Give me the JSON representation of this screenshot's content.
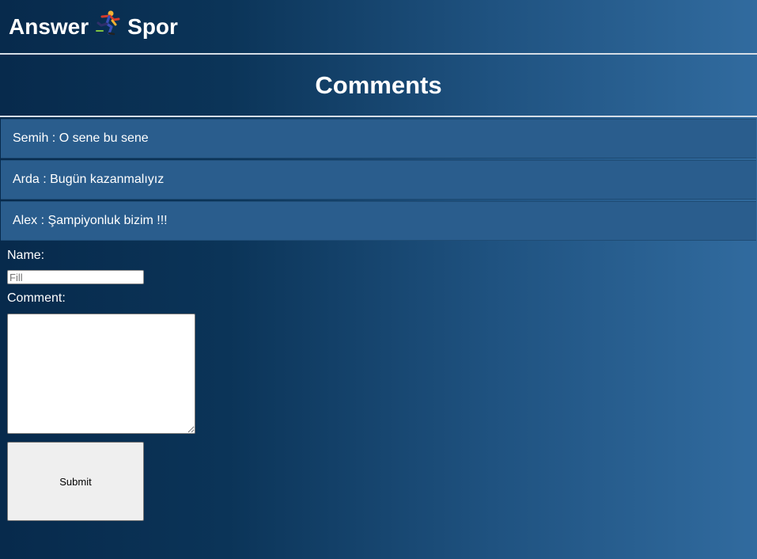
{
  "header": {
    "brand_left": "Answer",
    "brand_icon": "runner-icon",
    "brand_right": "Spor"
  },
  "page": {
    "title": "Comments"
  },
  "comments": [
    {
      "text": "Semih : O sene bu sene"
    },
    {
      "text": "Arda : Bugün kazanmalıyız"
    },
    {
      "text": "Alex : Şampiyonluk bizim !!!"
    }
  ],
  "form": {
    "name_label": "Name:",
    "name_placeholder": "Fill",
    "name_value": "",
    "comment_label": "Comment:",
    "comment_value": "",
    "submit_label": "Submit"
  }
}
